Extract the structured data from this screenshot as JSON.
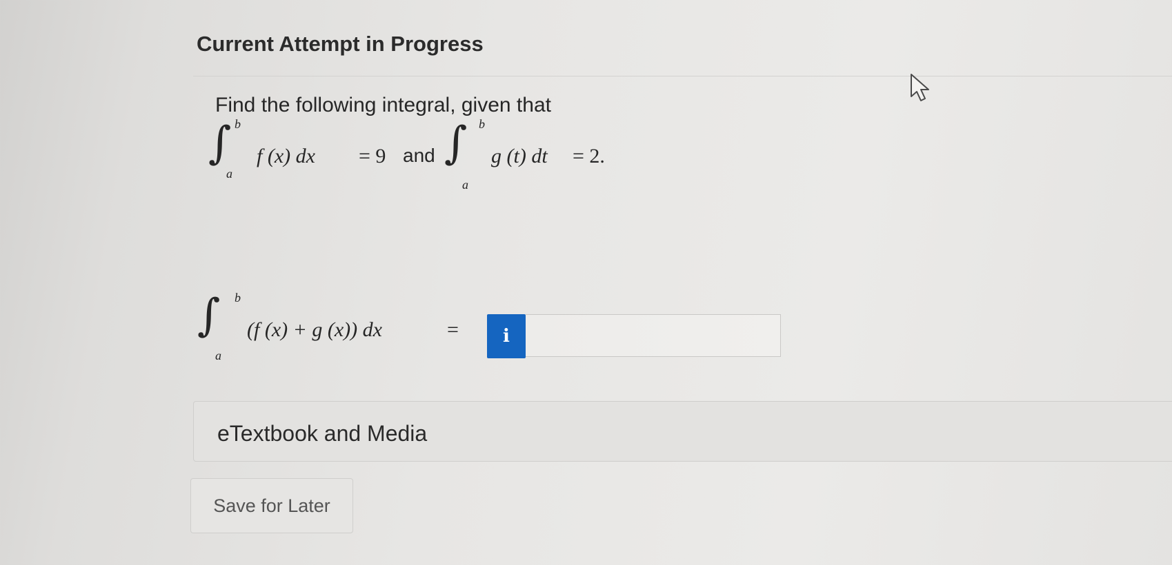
{
  "header": {
    "title": "Current Attempt in Progress"
  },
  "question": {
    "prompt": "Find the following integral, given that",
    "given_1": {
      "upper": "b",
      "lower": "a",
      "integrand": "f (x) dx",
      "equals": "= 9"
    },
    "connector": "and",
    "given_2": {
      "upper": "b",
      "lower": "a",
      "integrand": "g (t) dt",
      "equals": "= 2."
    },
    "target": {
      "upper": "b",
      "lower": "a",
      "integrand": "(f (x) + g (x)) dx",
      "equals": "="
    },
    "answer": {
      "info_label": "i",
      "value": "",
      "placeholder": ""
    }
  },
  "resources": {
    "label": "eTextbook and Media"
  },
  "actions": {
    "save_label": "Save for Later"
  },
  "colors": {
    "info_button": "#1565c0",
    "background": "#e7e6e4"
  },
  "icons": [
    "info-icon",
    "mouse-cursor-icon"
  ]
}
